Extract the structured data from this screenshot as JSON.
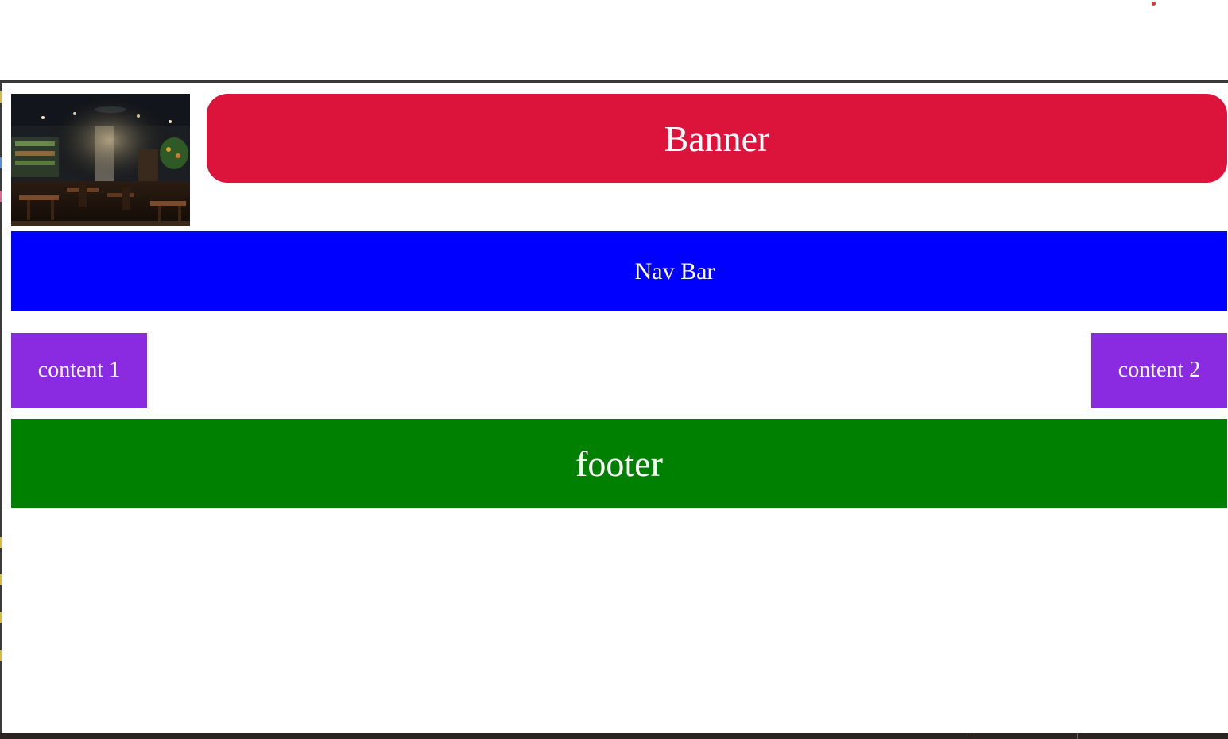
{
  "header": {
    "photo_icon": "restaurant-interior-photo",
    "banner_label": "Banner",
    "banner_color": "#dc143c"
  },
  "nav": {
    "label": "Nav Bar",
    "color": "#0000ff"
  },
  "content": {
    "items": [
      {
        "label": "content 1"
      },
      {
        "label": "content 2"
      }
    ],
    "color": "#8a2be2"
  },
  "footer": {
    "label": "footer",
    "color": "#008000"
  }
}
